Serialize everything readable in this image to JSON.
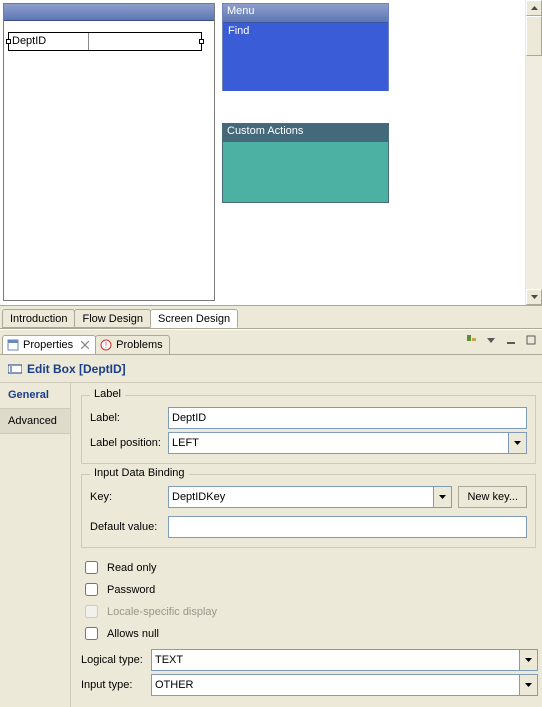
{
  "designer": {
    "field_label": "DeptID",
    "menu": {
      "title": "Menu",
      "items": [
        "Find"
      ]
    },
    "custom_actions": {
      "title": "Custom Actions"
    }
  },
  "design_tabs": {
    "introduction": "Introduction",
    "flow_design": "Flow Design",
    "screen_design": "Screen Design"
  },
  "view_tabs": {
    "properties": "Properties",
    "problems": "Problems"
  },
  "form": {
    "title": "Edit Box [DeptID]",
    "side": {
      "general": "General",
      "advanced": "Advanced"
    },
    "label_group": {
      "legend": "Label",
      "label_lbl": "Label:",
      "label_value": "DeptID",
      "pos_lbl": "Label position:",
      "pos_value": "LEFT"
    },
    "binding_group": {
      "legend": "Input Data Binding",
      "key_lbl": "Key:",
      "key_value": "DeptIDKey",
      "new_key_btn": "New key...",
      "default_lbl": "Default value:",
      "default_value": ""
    },
    "checks": {
      "read_only": "Read only",
      "password": "Password",
      "locale": "Locale-specific display",
      "allows_null": "Allows null"
    },
    "logical_type_lbl": "Logical type:",
    "logical_type_value": "TEXT",
    "input_type_lbl": "Input type:",
    "input_type_value": "OTHER"
  }
}
